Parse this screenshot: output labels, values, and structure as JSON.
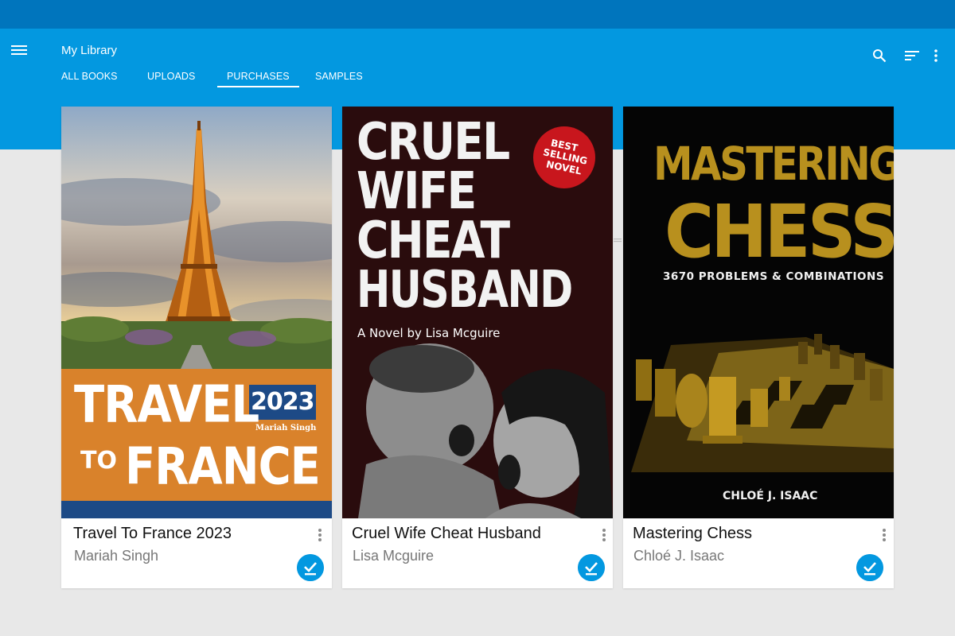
{
  "app": {
    "title": "My Library",
    "accent": "#0398e0",
    "status_bar_color": "#0075bd"
  },
  "tabs": [
    {
      "label": "ALL BOOKS",
      "selected": false
    },
    {
      "label": "UPLOADS",
      "selected": false
    },
    {
      "label": "PURCHASES",
      "selected": true
    },
    {
      "label": "SAMPLES",
      "selected": false
    }
  ],
  "toolbar": {
    "icons": [
      "menu-icon",
      "search-icon",
      "sort-icon",
      "more-vert-icon"
    ]
  },
  "books": [
    {
      "title": "Travel To France 2023",
      "author": "Mariah Singh",
      "downloaded": true,
      "cover": {
        "line1": "TRAVEL",
        "line2a": "TO",
        "line2b": "FRANCE",
        "year": "2023",
        "author": "Mariah Singh",
        "band_color": "#d9822b",
        "year_color": "#1d4a86"
      }
    },
    {
      "title": "Cruel Wife Cheat Husband",
      "author": "Lisa Mcguire",
      "downloaded": true,
      "cover": {
        "line1": "CRUEL",
        "line2": "WIFE",
        "line3": "CHEAT",
        "line4": "HUSBAND",
        "subtitle": "A Novel by Lisa Mcguire",
        "badge1": "BEST",
        "badge2": "SELLING",
        "badge3": "NOVEL",
        "bg_color": "#2a0c0d",
        "badge_color": "#c8161d"
      }
    },
    {
      "title": "Mastering Chess",
      "author": "Chloé J. Isaac",
      "downloaded": true,
      "cover": {
        "line1": "MASTERING",
        "line2": "CHESS",
        "subtitle": "3670 PROBLEMS & COMBINATIONS",
        "author": "CHLOÉ J. ISAAC",
        "title_color": "#b8901e"
      }
    }
  ]
}
